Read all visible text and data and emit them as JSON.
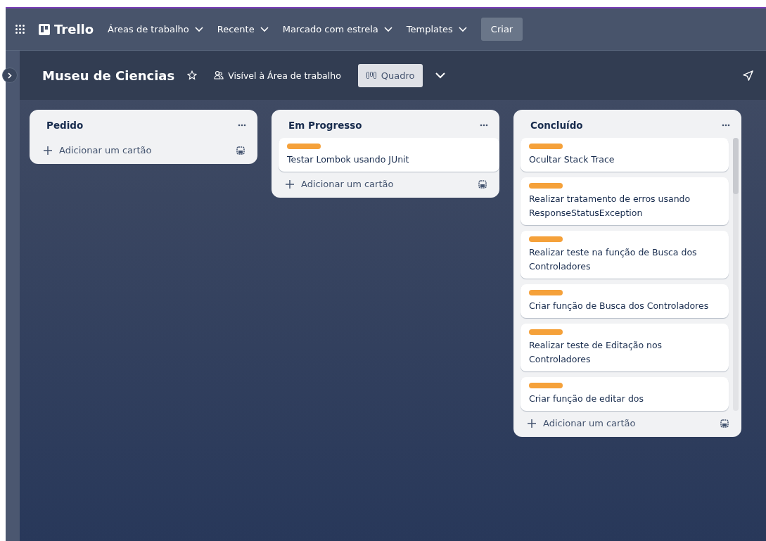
{
  "top_nav": {
    "logo": "Trello",
    "menus": [
      "Áreas de trabalho",
      "Recente",
      "Marcado com estrela",
      "Templates"
    ],
    "create_button": "Criar"
  },
  "board_header": {
    "title": "Museu de Ciencias",
    "visibility": "Visível à Área de trabalho",
    "view": "Quadro"
  },
  "lists": [
    {
      "title": "Pedido",
      "add_card": "Adicionar um cartão"
    },
    {
      "title": "Em Progresso",
      "cards": [
        "Testar Lombok usando JUnit"
      ],
      "add_card": "Adicionar um cartão"
    },
    {
      "title": "Concluído",
      "cards": [
        "Ocultar Stack Trace",
        "Realizar tratamento de erros usando ResponseStatusException",
        "Realizar teste na função de Busca dos Controladores",
        "Criar função de Busca dos Controladores",
        "Realizar teste de Editação nos Controladores",
        "Criar função de editar dos"
      ],
      "add_card": "Adicionar um cartão"
    }
  ]
}
